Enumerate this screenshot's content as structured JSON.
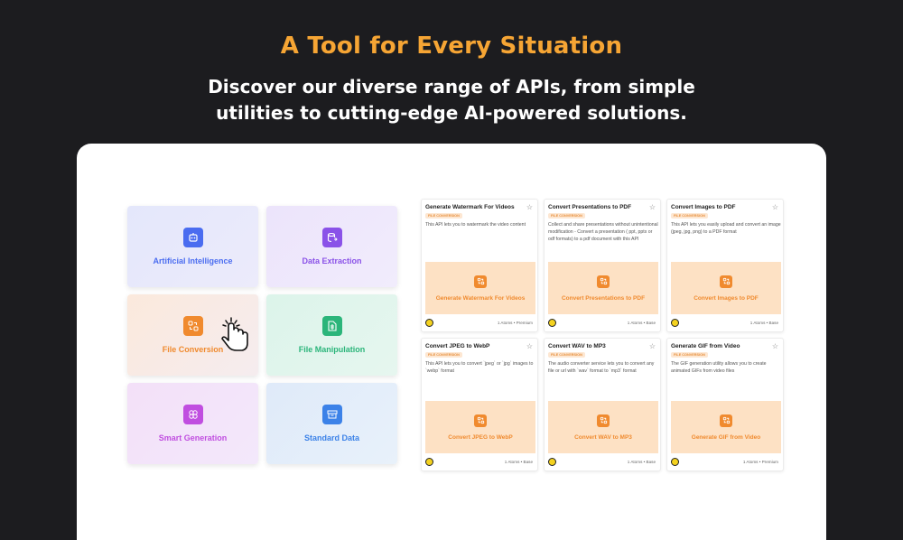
{
  "header": {
    "title": "A Tool for Every Situation",
    "subtitle": "Discover our diverse range of APIs, from simple utilities to cutting-edge AI-powered solutions."
  },
  "categories": [
    {
      "label": "Artificial Intelligence",
      "icon": "robot-icon",
      "color": "#4a6cf0"
    },
    {
      "label": "Data Extraction",
      "icon": "database-icon",
      "color": "#8a52e8"
    },
    {
      "label": "File Conversion",
      "icon": "convert-icon",
      "color": "#f08a2e"
    },
    {
      "label": "File Manipulation",
      "icon": "file-edit-icon",
      "color": "#2bb57a"
    },
    {
      "label": "Smart Generation",
      "icon": "brain-icon",
      "color": "#c04ee0"
    },
    {
      "label": "Standard Data",
      "icon": "archive-icon",
      "color": "#3c82e8"
    }
  ],
  "apis": [
    {
      "title": "Generate Watermark For Videos",
      "badge": "FILE CONVERSION",
      "description": "This API lets you to watermark the video content",
      "thumb_label": "Generate Watermark For Videos",
      "meta": "1 Atoms • Premium"
    },
    {
      "title": "Convert Presentations to PDF",
      "badge": "FILE CONVERSION",
      "description": "Collect and share presentations without unintentional modification - Convert a presentation ( ppt, pptx or odf formats) to a pdf document with this API",
      "thumb_label": "Convert Presentations to PDF",
      "meta": "1 Atoms • Base"
    },
    {
      "title": "Convert Images to PDF",
      "badge": "FILE CONVERSION",
      "description": "This API lets you easily upload and convert an image (jpeg, jpg, png) to a PDF format",
      "thumb_label": "Convert Images to PDF",
      "meta": "1 Atoms • Base"
    },
    {
      "title": "Convert JPEG to WebP",
      "badge": "FILE CONVERSION",
      "description": "This API lets you to convert `jpeg` or `jpg` images to `webp` format",
      "thumb_label": "Convert JPEG to WebP",
      "meta": "1 Atoms • Base"
    },
    {
      "title": "Convert WAV to MP3",
      "badge": "FILE CONVERSION",
      "description": "The audio converter service lets you to convert any file or url with `wav` format to `mp3` format",
      "thumb_label": "Convert WAV to MP3",
      "meta": "1 Atoms • Base"
    },
    {
      "title": "Generate GIF from Video",
      "badge": "FILE CONVERSION",
      "description": "The GIF generation utility allows you to create animated GIFs from video files",
      "thumb_label": "Generate GIF from Video",
      "meta": "1 Atoms • Premium"
    }
  ],
  "icons": {
    "star": "star-icon",
    "cursor": "hand-pointer-icon",
    "avatar": "avatar-icon"
  }
}
